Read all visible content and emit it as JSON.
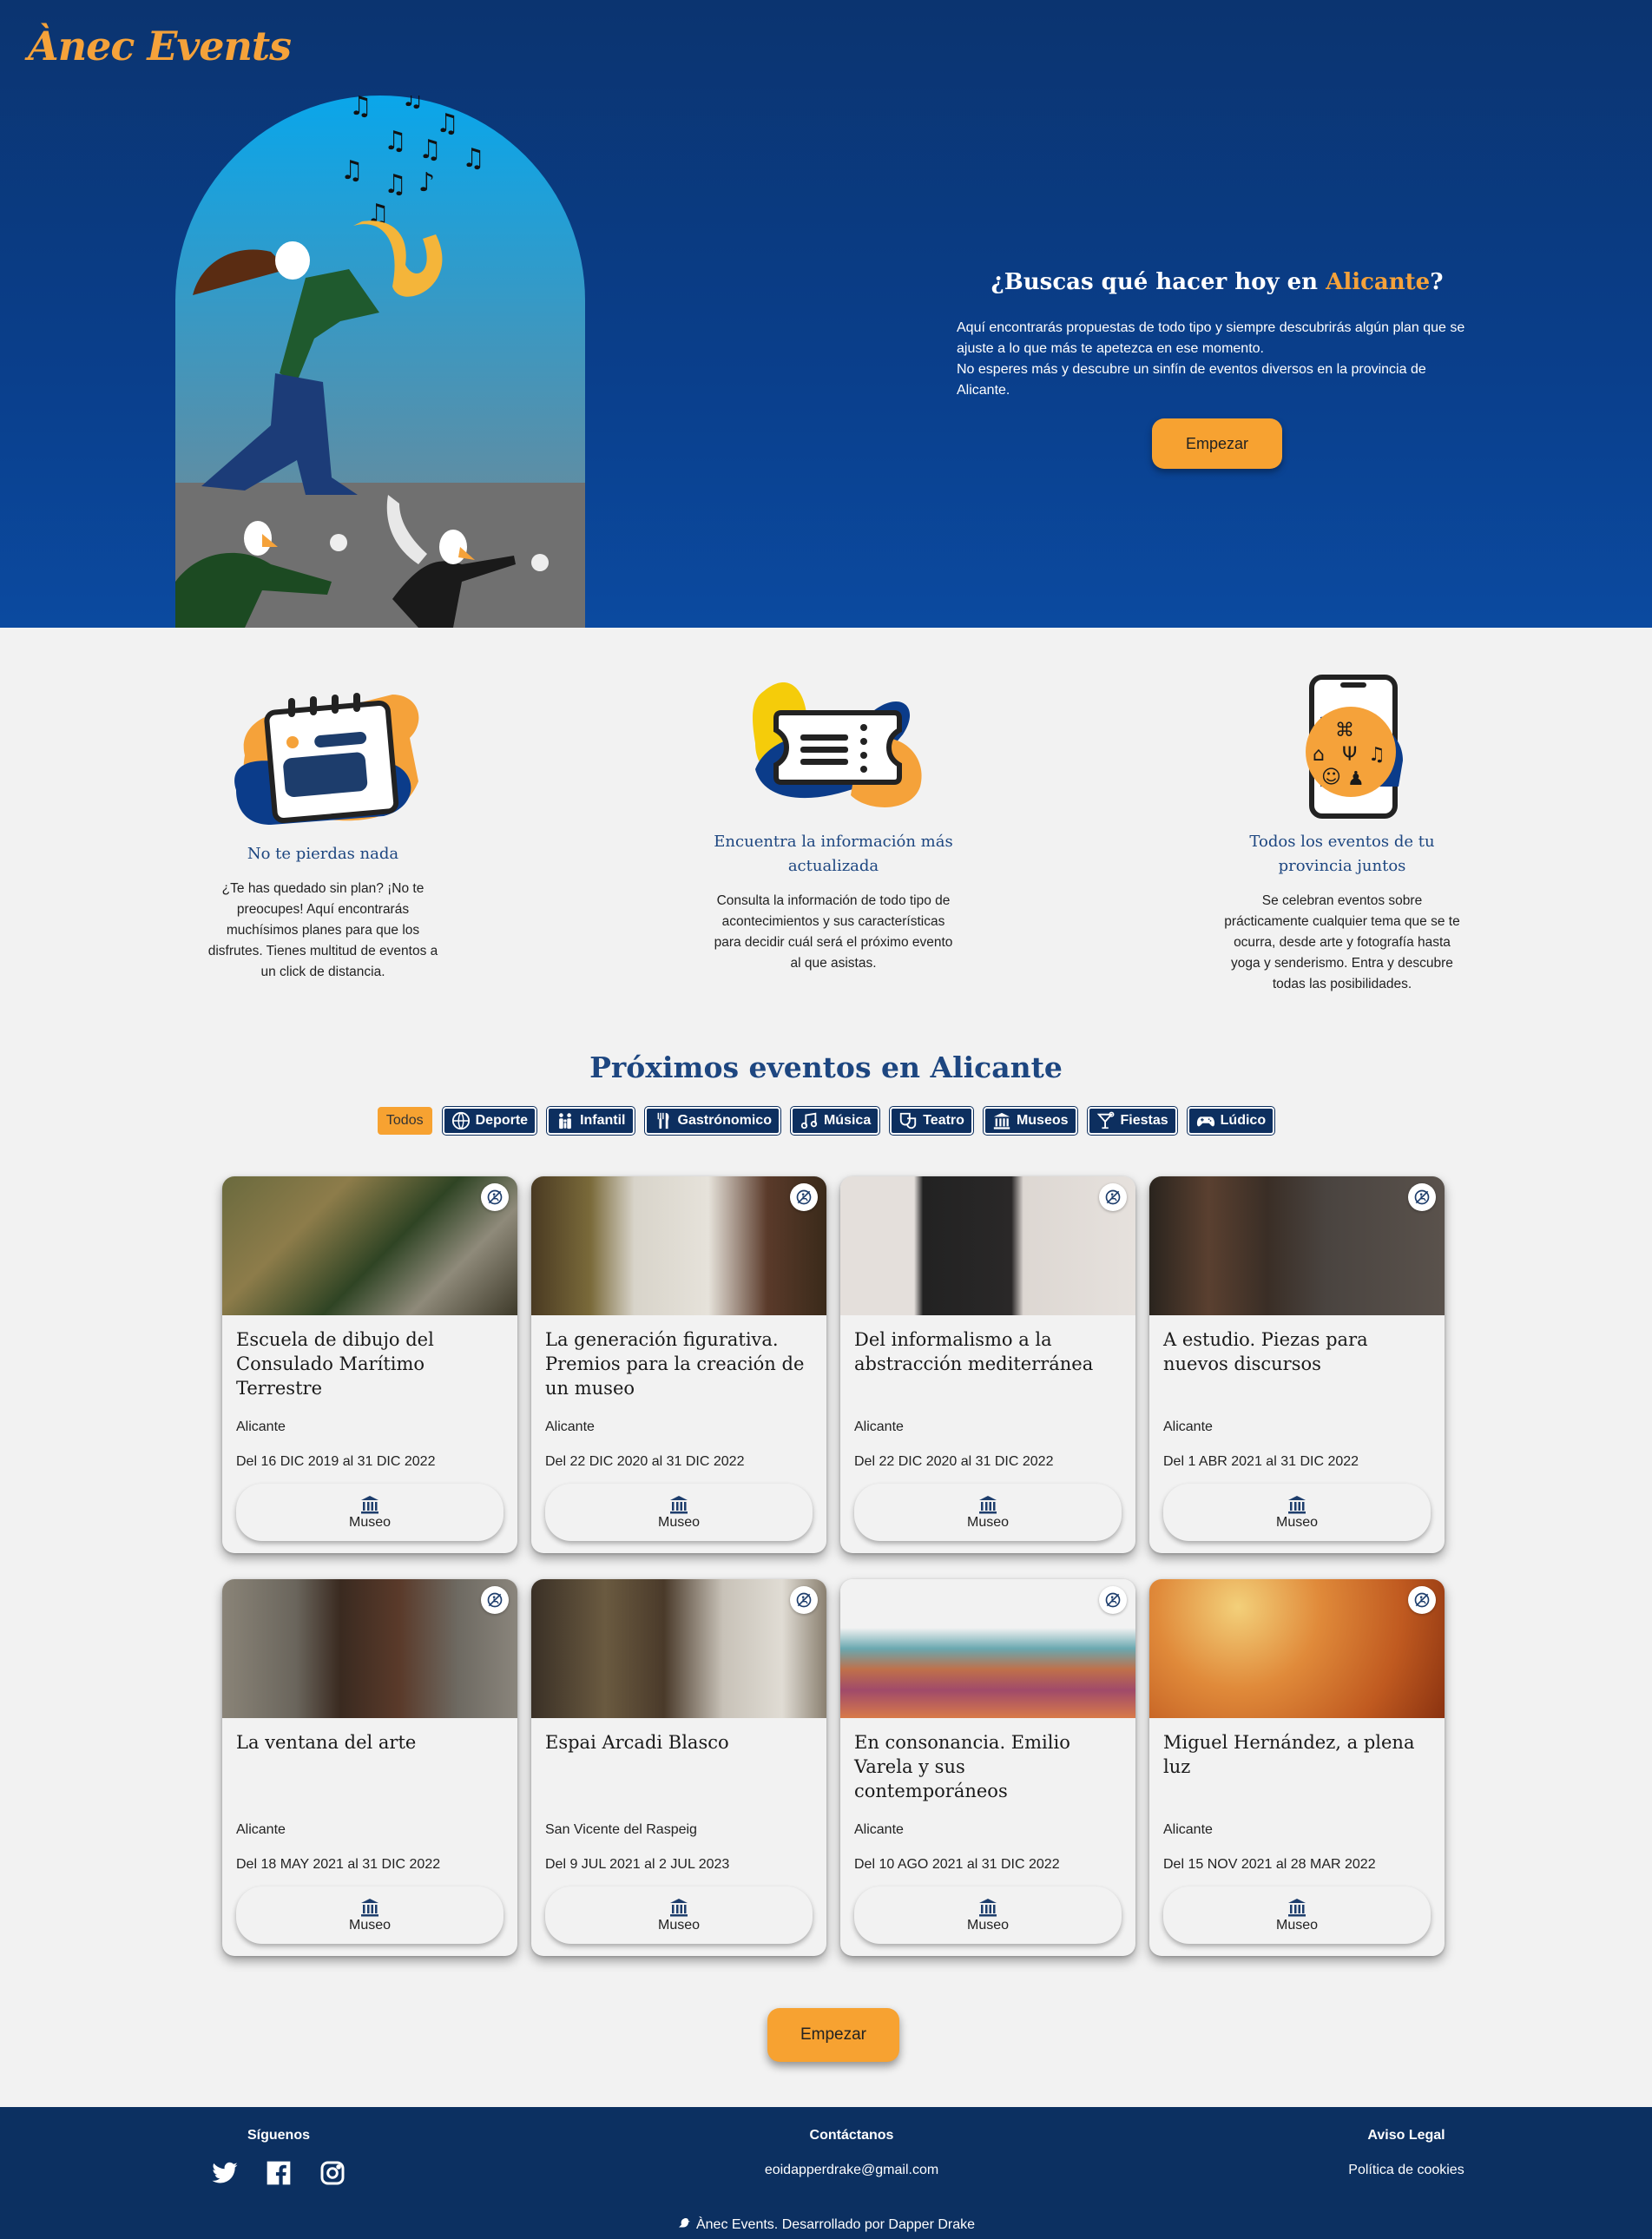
{
  "brand": {
    "logo_text": "Ànec Events"
  },
  "hero": {
    "title_prefix": "¿Buscas qué hacer hoy en ",
    "title_city": "Alicante",
    "title_suffix": "?",
    "description_line1": "Aquí encontrarás propuestas de todo tipo y siempre descubrirás algún plan que se ajuste a lo que más te apetezca en ese momento.",
    "description_line2": "No esperes más y descubre un sinfín de eventos diversos en la provincia de Alicante.",
    "cta_label": "Empezar"
  },
  "features": [
    {
      "title": "No te pierdas nada",
      "description": "¿Te has quedado sin plan? ¡No te preocupes! Aquí encontrarás muchísimos planes para que los disfrutes. Tienes multitud de eventos a un click de distancia.",
      "icon": "calendar-icon"
    },
    {
      "title": "Encuentra la información más actualizada",
      "description": "Consulta la información de todo tipo de acontecimientos y sus características para decidir cuál será el próximo evento al que asistas.",
      "icon": "ticket-icon"
    },
    {
      "title": "Todos los eventos de tu provincia juntos",
      "description": "Se celebran eventos sobre prácticamente cualquier tema que se te ocurra, desde arte y fotografía hasta yoga y senderismo. Entra y descubre todas las posibilidades.",
      "icon": "phone-icon"
    }
  ],
  "events": {
    "section_title": "Próximos eventos en Alicante",
    "filters": [
      {
        "label": "Todos",
        "icon": "",
        "active": true
      },
      {
        "label": "Deporte",
        "icon": "ball-icon"
      },
      {
        "label": "Infantil",
        "icon": "family-icon"
      },
      {
        "label": "Gastrónomico",
        "icon": "cutlery-icon"
      },
      {
        "label": "Música",
        "icon": "music-icon"
      },
      {
        "label": "Teatro",
        "icon": "theater-icon"
      },
      {
        "label": "Museos",
        "icon": "museum-icon"
      },
      {
        "label": "Fiestas",
        "icon": "cocktail-icon"
      },
      {
        "label": "Lúdico",
        "icon": "gamepad-icon"
      }
    ],
    "cards": [
      {
        "title": "Escuela de dibujo del Consulado Marítimo Terrestre",
        "location": "Alicante",
        "dates": "Del 16 DIC 2019 al 31 DIC 2022",
        "category": "Museo"
      },
      {
        "title": "La generación figurativa. Premios para la creación de un museo",
        "location": "Alicante",
        "dates": "Del 22 DIC 2020 al 31 DIC 2022",
        "category": "Museo"
      },
      {
        "title": "Del informalismo a la abstracción mediterránea",
        "location": "Alicante",
        "dates": "Del 22 DIC 2020 al 31 DIC 2022",
        "category": "Museo"
      },
      {
        "title": "A estudio. Piezas para nuevos discursos",
        "location": "Alicante",
        "dates": "Del 1 ABR 2021 al 31 DIC 2022",
        "category": "Museo"
      },
      {
        "title": "La ventana del arte",
        "location": "Alicante",
        "dates": "Del 18 MAY 2021 al 31 DIC 2022",
        "category": "Museo"
      },
      {
        "title": "Espai Arcadi Blasco",
        "location": "San Vicente del Raspeig",
        "dates": "Del 9 JUL 2021 al 2 JUL 2023",
        "category": "Museo"
      },
      {
        "title": "En consonancia. Emilio Varela y sus contemporáneos",
        "location": "Alicante",
        "dates": "Del 10 AGO 2021 al 31 DIC 2022",
        "category": "Museo"
      },
      {
        "title": "Miguel Hernández, a plena luz",
        "location": "Alicante",
        "dates": "Del 15 NOV 2021 al 28 MAR 2022",
        "category": "Museo"
      }
    ],
    "cta_label": "Empezar"
  },
  "footer": {
    "follow_label": "Síguenos",
    "contact_label": "Contáctanos",
    "email": "eoidapperdrake@gmail.com",
    "legal_label": "Aviso Legal",
    "cookies_label": "Política de cookies",
    "copyright": "Ànec Events. Desarrollado por Dapper Drake",
    "socials": [
      "twitter-icon",
      "facebook-icon",
      "instagram-icon"
    ]
  }
}
